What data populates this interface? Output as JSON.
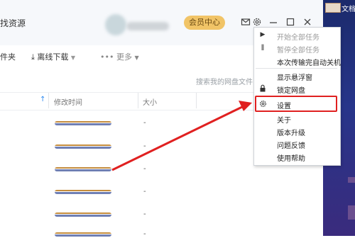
{
  "header": {
    "find_resources": "找资源",
    "vip_button": "会员中心",
    "icons": [
      "mail-icon",
      "gear-icon",
      "minimize-icon",
      "maximize-icon",
      "close-icon"
    ]
  },
  "toolbar": {
    "folder_partial": "件夹",
    "offline_download": "离线下载",
    "more": "••• 更多",
    "search_placeholder": "搜索我的网盘文件"
  },
  "table": {
    "columns": [
      "修改时间",
      "大小"
    ],
    "rows": [
      {
        "size": "-"
      },
      {
        "size": "-"
      },
      {
        "size": "-"
      },
      {
        "size": "-"
      },
      {
        "size": "-"
      },
      {
        "size": "-"
      }
    ]
  },
  "desktop": {
    "icon_label": "文档"
  },
  "menu": {
    "items": [
      {
        "label": "开始全部任务",
        "enabled": false,
        "icon": "play-icon"
      },
      {
        "label": "暂停全部任务",
        "enabled": false,
        "icon": "pause-icon"
      },
      {
        "label": "本次传输完自动关机",
        "enabled": true
      },
      {
        "label": "显示悬浮窗",
        "enabled": true
      },
      {
        "label": "锁定网盘",
        "enabled": true,
        "icon": "lock-icon"
      },
      {
        "label": "设置",
        "enabled": true,
        "icon": "gear-icon",
        "highlighted": true
      },
      {
        "label": "关于",
        "enabled": true
      },
      {
        "label": "版本升级",
        "enabled": true
      },
      {
        "label": "问题反馈",
        "enabled": true
      },
      {
        "label": "使用帮助",
        "enabled": true
      }
    ]
  },
  "colors": {
    "vip": "#f1c467",
    "highlight": "#e02020",
    "arrow": "#e02020",
    "accent": "#2b88f0"
  }
}
